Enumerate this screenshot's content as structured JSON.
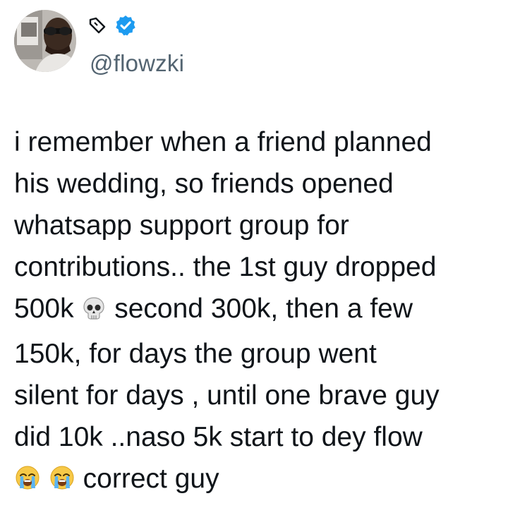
{
  "tweet": {
    "author": {
      "handle": "@flowzki",
      "badge_icon": "verified-badge-icon",
      "name_icon": "pen-nib-icon",
      "badge_color": "#1d9bf0"
    },
    "lines": [
      "i remember when a friend planned",
      "his wedding, so friends opened",
      "whatsapp support group for",
      "contributions.. the 1st guy dropped"
    ],
    "line5_a": "500k ",
    "line5_b": " second 300k, then a few",
    "line6": "150k, for days the group went",
    "line7": "silent for days , until one brave guy",
    "line8": "did 10k ..naso 5k start to dey flow",
    "line9_end": " correct guy",
    "emojis": {
      "skull": "skull-emoji",
      "crying": "loudly-crying-face-emoji"
    }
  }
}
